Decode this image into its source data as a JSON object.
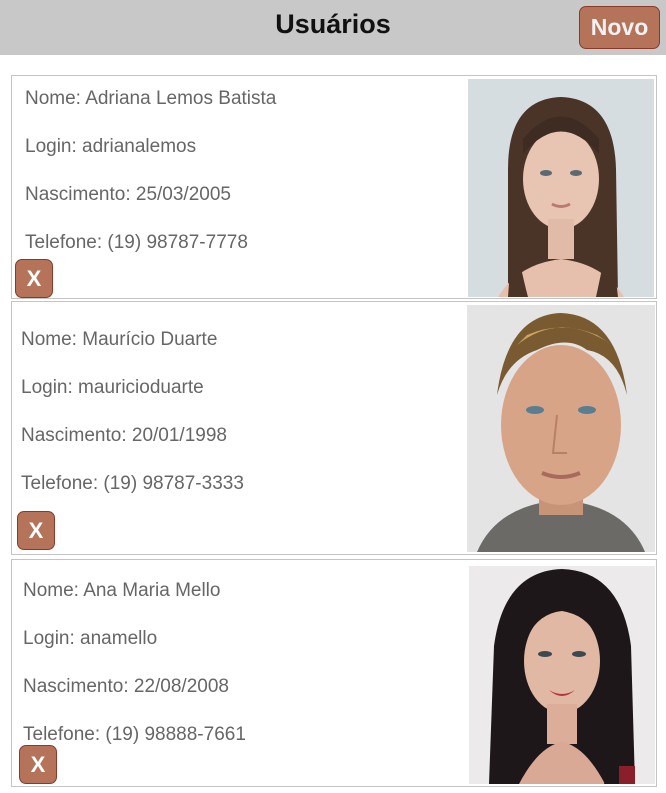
{
  "header": {
    "title": "Usuários",
    "new_button_label": "Novo"
  },
  "users": [
    {
      "name_line": "Nome: Adriana Lemos Batista",
      "login_line": "Login: adrianalemos",
      "birth_line": "Nascimento: 25/03/2005",
      "phone_line": "Telefone: (19) 98787-7778",
      "delete_label": "X",
      "photo": "woman-brown-hair-photo"
    },
    {
      "name_line": "Nome: Maurício Duarte",
      "login_line": "Login: mauricioduarte",
      "birth_line": "Nascimento: 20/01/1998",
      "phone_line": "Telefone: (19) 98787-3333",
      "delete_label": "X",
      "photo": "man-blond-hair-photo"
    },
    {
      "name_line": "Nome: Ana Maria Mello",
      "login_line": "Login: anamello",
      "birth_line": "Nascimento: 22/08/2008",
      "phone_line": "Telefone: (19) 98888-7661",
      "delete_label": "X",
      "photo": "woman-black-hair-photo"
    }
  ],
  "colors": {
    "header_bg": "#c8c8c8",
    "button_bg": "#b5735a",
    "button_border": "#8b3a2a",
    "text": "#666666"
  }
}
